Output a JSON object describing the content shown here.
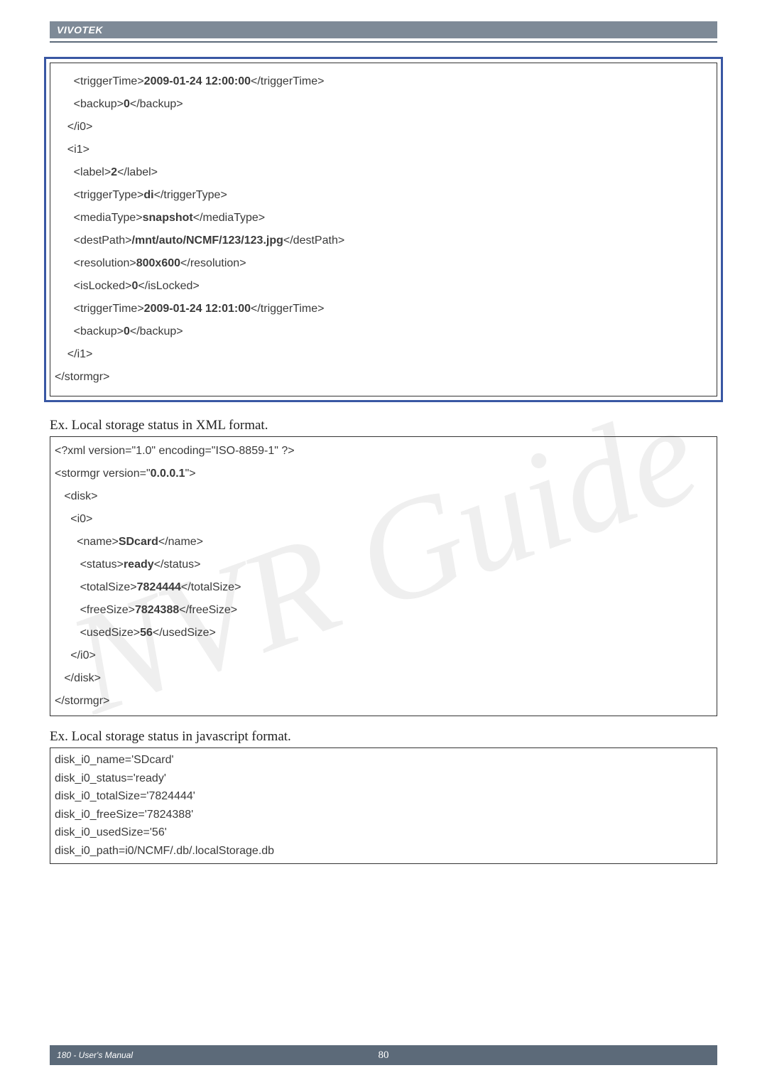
{
  "header": {
    "brand": "VIVOTEK"
  },
  "watermark": "NVR Guide",
  "box1": {
    "l01a": "      <triggerTime>",
    "l01b": "2009-01-24 12:00:00",
    "l01c": "</triggerTime>",
    "l02a": "      <backup>",
    "l02b": "0",
    "l02c": "</backup>",
    "l03": "    </i0>",
    "l04": "    <i1>",
    "l05a": "      <label>",
    "l05b": "2",
    "l05c": "</label>",
    "l06a": "      <triggerType>",
    "l06b": "di",
    "l06c": "</triggerType>",
    "l07a": "      <mediaType>",
    "l07b": "snapshot",
    "l07c": "</mediaType>",
    "l08a": "      <destPath>",
    "l08b": "/mnt/auto/NCMF/123/123.jpg",
    "l08c": "</destPath>",
    "l09a": "      <resolution>",
    "l09b": "800x600",
    "l09c": "</resolution>",
    "l10a": "      <isLocked>",
    "l10b": "0",
    "l10c": "</isLocked>",
    "l11a": "      <triggerTime>",
    "l11b": "2009-01-24 12:01:00",
    "l11c": "</triggerTime>",
    "l12a": "      <backup>",
    "l12b": "0",
    "l12c": "</backup>",
    "l13": "    </i1>",
    "l14": "</stormgr>"
  },
  "label2": "Ex. Local storage status in XML format.",
  "box2": {
    "l01": "<?xml version=\"1.0\" encoding=\"ISO-8859-1\" ?>",
    "l02a": "<stormgr version=\"",
    "l02b": "0.0.0.1",
    "l02c": "\">",
    "l03": "   <disk>",
    "l04": "     <i0>",
    "l05a": "       <name>",
    "l05b": "SDcard",
    "l05c": "</name>",
    "l06a": "        <status>",
    "l06b": "ready",
    "l06c": "</status>",
    "l07a": "        <totalSize>",
    "l07b": "7824444",
    "l07c": "</totalSize>",
    "l08a": "        <freeSize>",
    "l08b": "7824388",
    "l08c": "</freeSize>",
    "l09a": "        <usedSize>",
    "l09b": "56",
    "l09c": "</usedSize>",
    "l10": "     </i0>",
    "l11": "   </disk>",
    "l12": "</stormgr>"
  },
  "label3": "Ex. Local storage status in javascript format.",
  "box3": {
    "l01": "disk_i0_name='SDcard'",
    "l02": "disk_i0_status='ready'",
    "l03": "disk_i0_totalSize='7824444'",
    "l04": "disk_i0_freeSize='7824388'",
    "l05": "disk_i0_usedSize='56'",
    "l06": "disk_i0_path=i0/NCMF/.db/.localStorage.db"
  },
  "footer": {
    "left": "180 - User's Manual",
    "center": "80"
  }
}
